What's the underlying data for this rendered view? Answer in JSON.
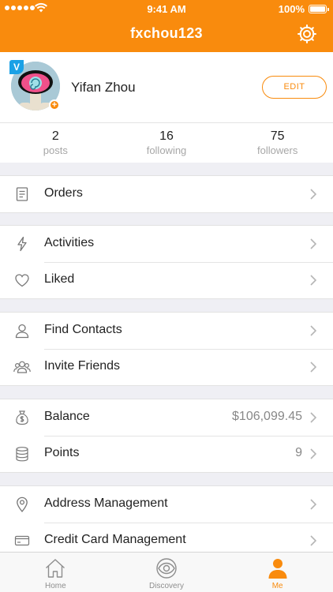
{
  "status_bar": {
    "time": "9:41 AM",
    "battery": "100%"
  },
  "nav": {
    "title": "fxchou123",
    "settings_icon": "gear-icon"
  },
  "profile": {
    "name": "Yifan Zhou",
    "verified_badge": "V",
    "add_badge": "+",
    "edit_label": "EDIT"
  },
  "stats": [
    {
      "value": "2",
      "label": "posts"
    },
    {
      "value": "16",
      "label": "following"
    },
    {
      "value": "75",
      "label": "followers"
    }
  ],
  "menu": {
    "orders": {
      "label": "Orders",
      "icon": "document-icon"
    },
    "activities": {
      "label": "Activities",
      "icon": "lightning-icon"
    },
    "liked": {
      "label": "Liked",
      "icon": "heart-icon"
    },
    "find_contacts": {
      "label": "Find Contacts",
      "icon": "person-icon"
    },
    "invite_friends": {
      "label": "Invite Friends",
      "icon": "people-icon"
    },
    "balance": {
      "label": "Balance",
      "value": "$106,099.45",
      "icon": "money-bag-icon"
    },
    "points": {
      "label": "Points",
      "value": "9",
      "icon": "coin-stack-icon"
    },
    "address": {
      "label": "Address Management",
      "icon": "location-pin-icon"
    },
    "credit_card": {
      "label": "Credit Card Management",
      "icon": "credit-card-icon"
    }
  },
  "tabs": [
    {
      "label": "Home",
      "icon": "home-icon",
      "active": false
    },
    {
      "label": "Discovery",
      "icon": "eye-icon",
      "active": false
    },
    {
      "label": "Me",
      "icon": "person-icon",
      "active": true
    }
  ],
  "colors": {
    "accent": "#f98b0d",
    "background": "#efeff4",
    "text": "#222222",
    "muted": "#a7a7a7"
  }
}
